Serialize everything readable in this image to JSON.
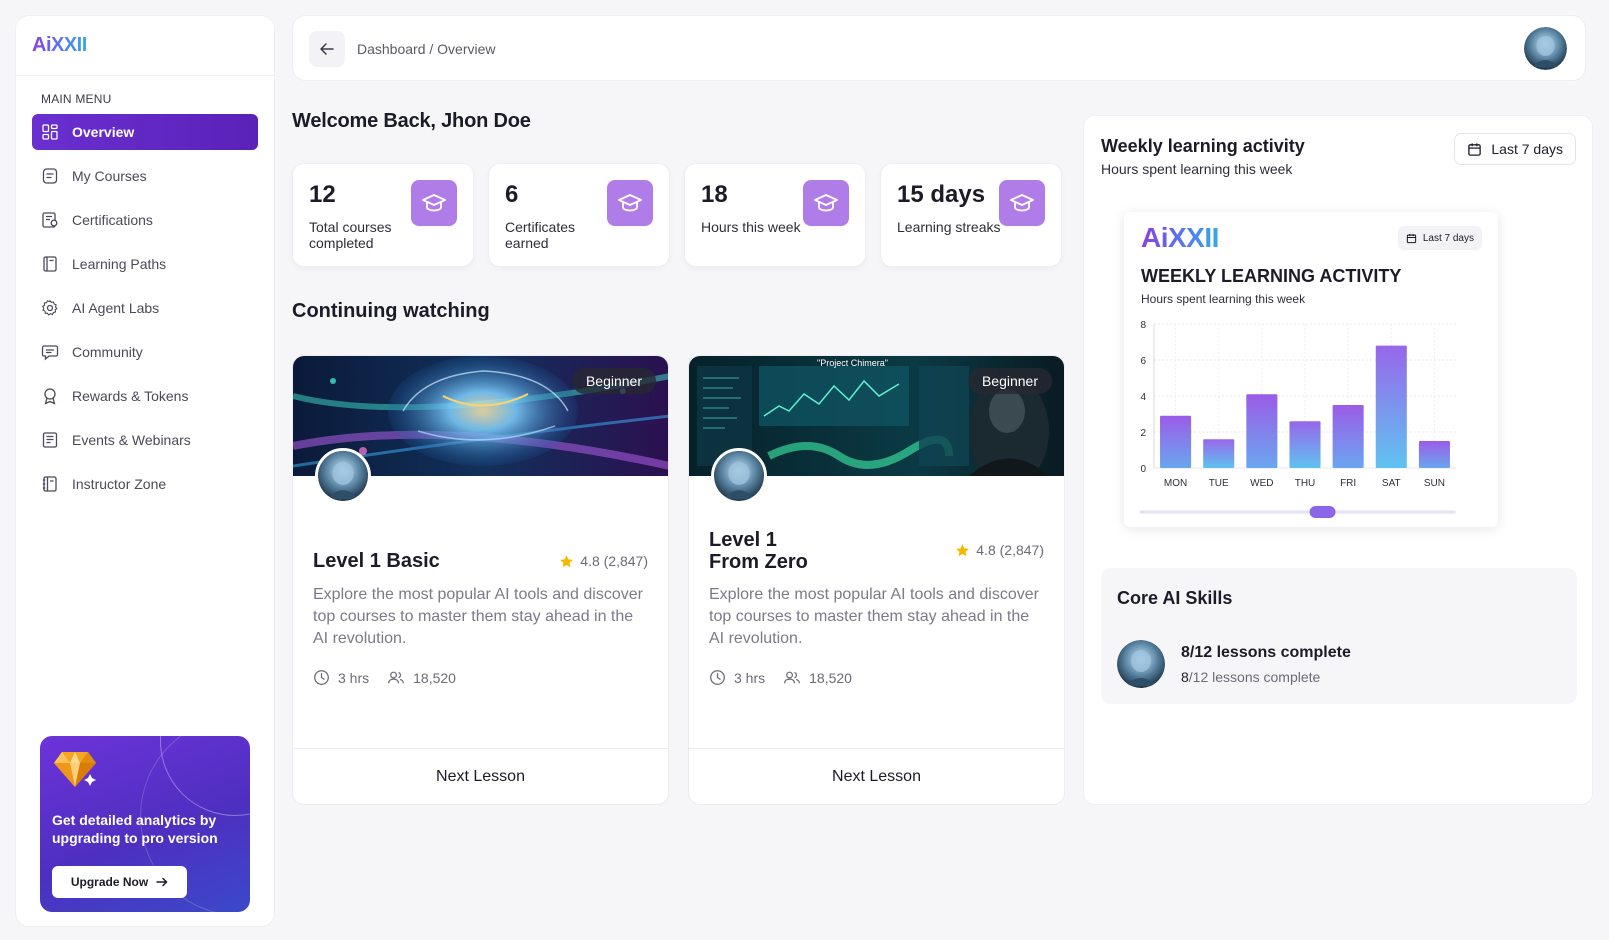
{
  "brand": {
    "logo_text": "AiXXII",
    "colors": {
      "primary": "#6a2fd0",
      "badge": "#b07de8",
      "star": "#f5b800"
    }
  },
  "sidebar": {
    "menu_title": "MAIN MENU",
    "items": [
      {
        "label": "Overview",
        "icon": "grid-icon",
        "active": true
      },
      {
        "label": "My Courses",
        "icon": "document-icon"
      },
      {
        "label": "Certifications",
        "icon": "certificate-icon"
      },
      {
        "label": "Learning Paths",
        "icon": "book-icon"
      },
      {
        "label": "AI Agent Labs",
        "icon": "gear-icon"
      },
      {
        "label": "Community",
        "icon": "chat-icon"
      },
      {
        "label": "Rewards & Tokens",
        "icon": "medal-icon"
      },
      {
        "label": "Events & Webinars",
        "icon": "calendar-list-icon"
      },
      {
        "label": "Instructor Zone",
        "icon": "notebook-icon"
      }
    ],
    "promo": {
      "text": "Get detailed analytics by upgrading to pro version",
      "button": "Upgrade Now"
    }
  },
  "header": {
    "breadcrumb": "Dashboard / Overview"
  },
  "welcome": "Welcome Back, Jhon Doe",
  "stats": [
    {
      "value": "12",
      "label": "Total courses completed"
    },
    {
      "value": "6",
      "label": "Certificates earned"
    },
    {
      "value": "18",
      "label": "Hours this week"
    },
    {
      "value": "15 days",
      "label": "Learning streaks"
    }
  ],
  "continuing": {
    "title": "Continuing watching",
    "courses": [
      {
        "badge": "Beginner",
        "title": "Level 1 Basic",
        "rating": "4.8 (2,847)",
        "description": "Explore the most popular AI tools and discover top courses to master them stay ahead in the AI revolution.",
        "duration": "3 hrs",
        "learners": "18,520",
        "cta": "Next Lesson"
      },
      {
        "badge": "Beginner",
        "title": "Level 1 From Zero",
        "rating": "4.8 (2,847)",
        "description": "Explore the most popular AI tools and discover top courses to master them stay ahead in the AI revolution.",
        "duration": "3 hrs",
        "learners": "18,520",
        "cta": "Next Lesson",
        "thumb_caption": "\"Project Chimera\""
      }
    ]
  },
  "activity": {
    "title": "Weekly learning activity",
    "subtitle": "Hours spent learning this week",
    "range": "Last 7 days",
    "card": {
      "logo": "AiXXII",
      "range": "Last 7 days",
      "title": "WEEKLY LEARNING ACTIVITY",
      "subtitle": "Hours spent learning this week"
    }
  },
  "chart_data": {
    "type": "bar",
    "title": "WEEKLY LEARNING ACTIVITY",
    "subtitle": "Hours spent learning this week",
    "categories": [
      "MON",
      "TUE",
      "WED",
      "THU",
      "FRI",
      "SAT",
      "SUN"
    ],
    "values": [
      2.9,
      1.6,
      4.1,
      2.6,
      3.5,
      6.8,
      1.5
    ],
    "yticks": [
      0,
      2,
      4,
      6,
      8
    ],
    "ylim": [
      0,
      8
    ],
    "grid": true,
    "scroll_position": 0.58
  },
  "skills": {
    "title": "Core AI Skills",
    "main": "8/12 lessons complete",
    "sub_done": "8",
    "sub_rest": "/12 lessons complete"
  }
}
